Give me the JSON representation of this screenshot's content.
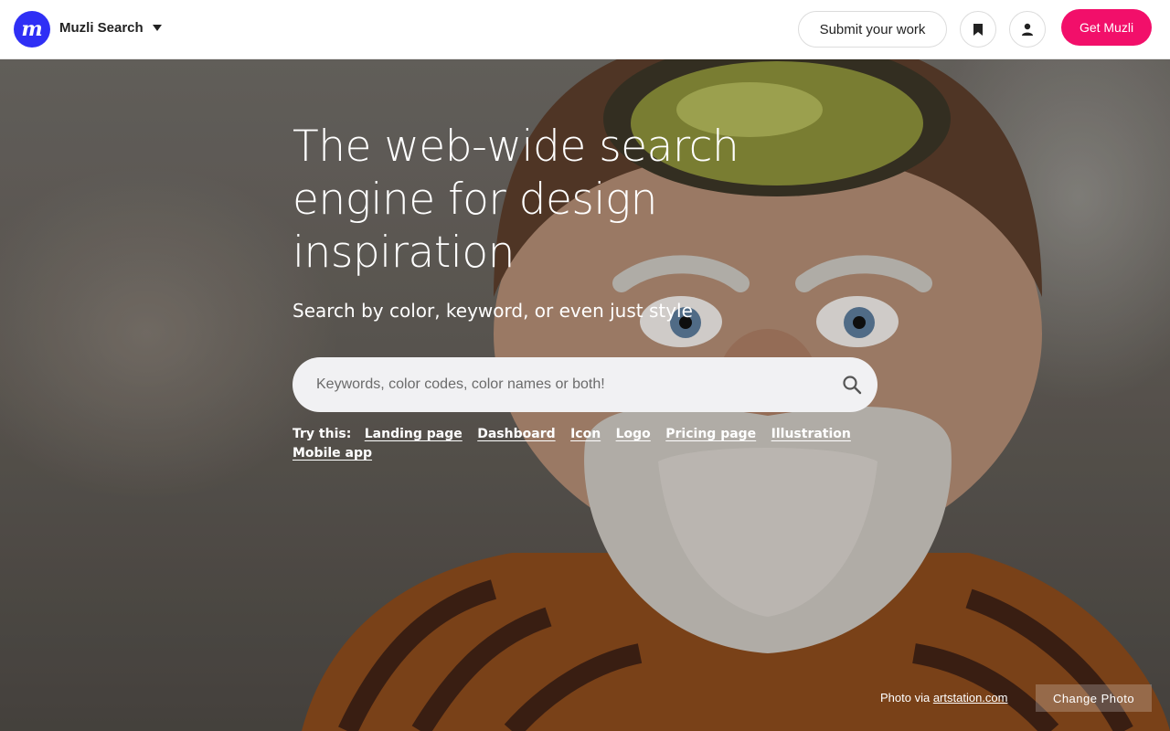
{
  "header": {
    "logo_letter": "m",
    "brand": "Muzli Search",
    "submit_label": "Submit your work",
    "get_label": "Get Muzli"
  },
  "hero": {
    "headline": "The web-wide search engine for design inspiration",
    "subline": "Search by color, keyword, or even just style",
    "search": {
      "placeholder": "Keywords, color codes, color names or both!",
      "value": ""
    },
    "try_label": "Try this:",
    "suggestions": [
      "Landing page",
      "Dashboard",
      "Icon",
      "Logo",
      "Pricing page",
      "Illustration",
      "Mobile app"
    ]
  },
  "footer": {
    "credit_prefix": "Photo via",
    "credit_link": "artstation.com",
    "change_photo_label": "Change Photo"
  },
  "icons": {
    "logo": "muzli-logo-icon",
    "dropdown": "caret-down-icon",
    "bookmark": "bookmark-icon",
    "account": "person-icon",
    "search": "search-icon"
  },
  "colors": {
    "logo_bg": "#2f2ff5",
    "cta_bg": "#f20f6a",
    "search_bg": "#f1f1f3"
  }
}
